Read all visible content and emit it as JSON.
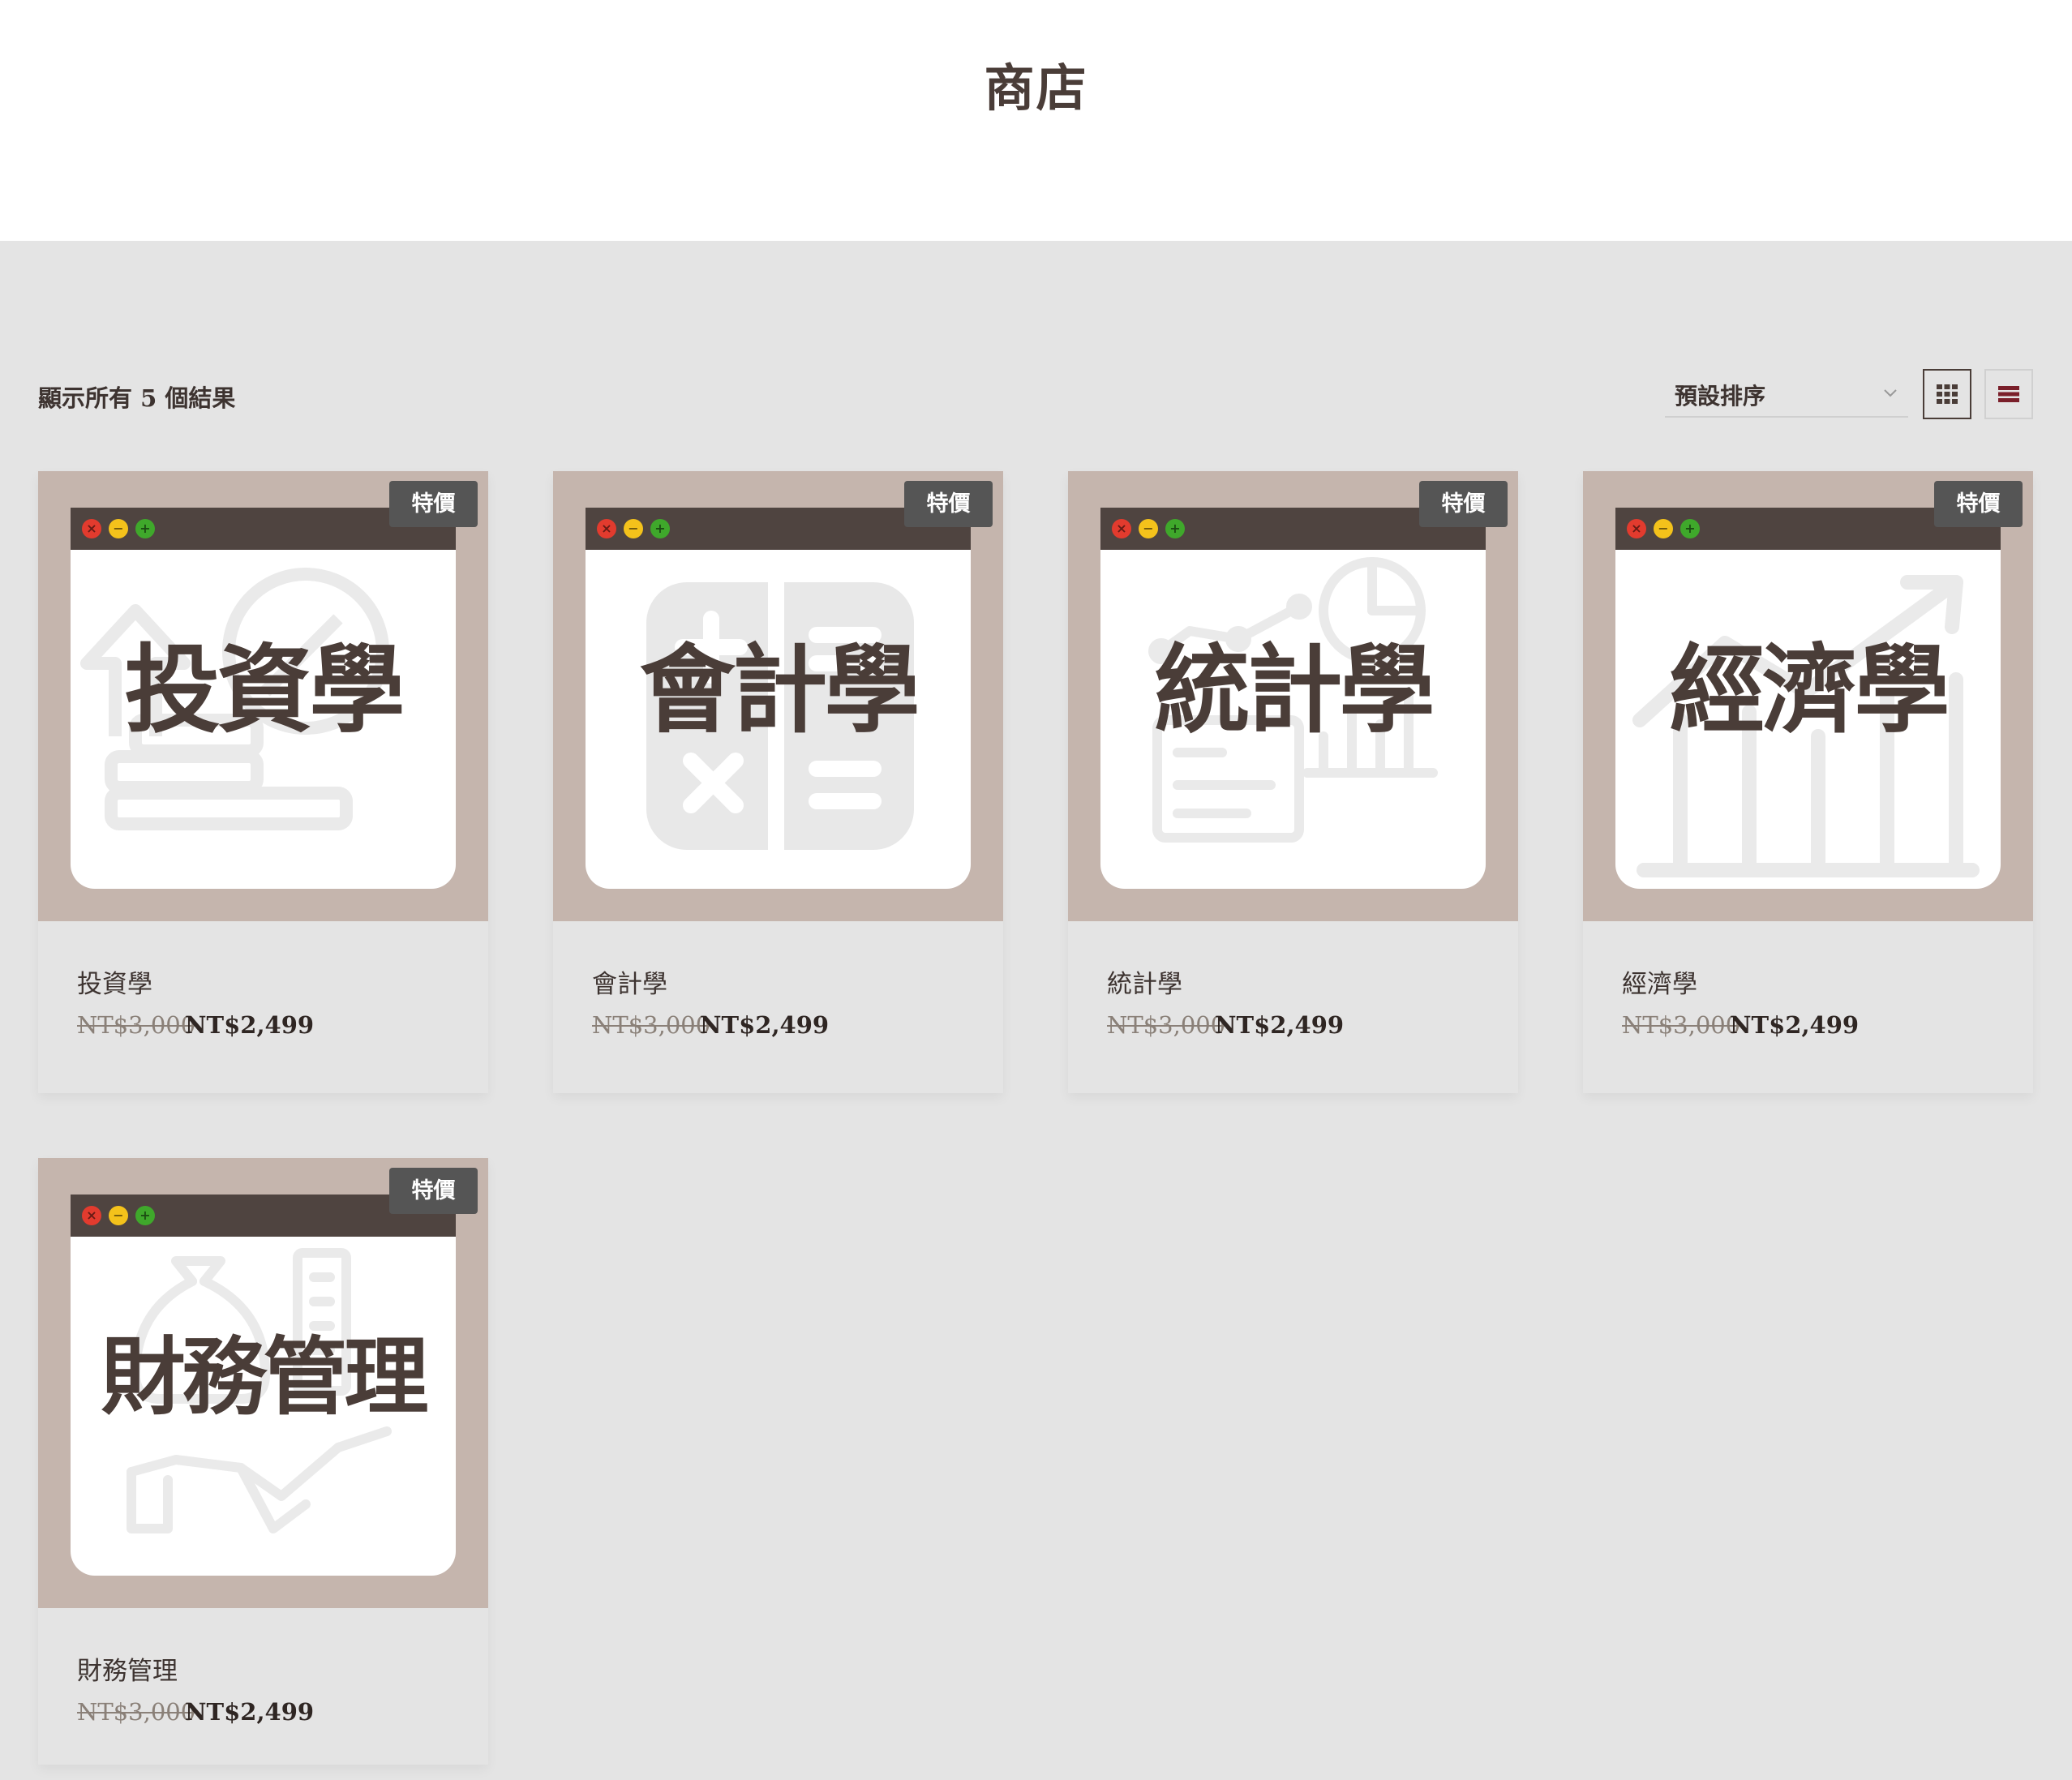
{
  "page": {
    "title": "商店"
  },
  "toolbar": {
    "result_count": "顯示所有 5 個結果",
    "sort_label": "預設排序"
  },
  "badges": {
    "sale": "特價"
  },
  "products": [
    {
      "name": "投資學",
      "cover_text": "投資學",
      "price_regular": "NT$3,000",
      "price_sale": "NT$2,499",
      "icon": "investment-icon"
    },
    {
      "name": "會計學",
      "cover_text": "會計學",
      "price_regular": "NT$3,000",
      "price_sale": "NT$2,499",
      "icon": "calculator-icon"
    },
    {
      "name": "統計學",
      "cover_text": "統計學",
      "price_regular": "NT$3,000",
      "price_sale": "NT$2,499",
      "icon": "statistics-chart-icon"
    },
    {
      "name": "經濟學",
      "cover_text": "經濟學",
      "price_regular": "NT$3,000",
      "price_sale": "NT$2,499",
      "icon": "economics-trend-icon"
    },
    {
      "name": "財務管理",
      "cover_text": "財務管理",
      "price_regular": "NT$3,000",
      "price_sale": "NT$2,499",
      "icon": "finance-money-icon"
    }
  ],
  "colors": {
    "accent": "#4a3d38",
    "thumb_bg": "#c5b5ad",
    "badge_bg": "#555555",
    "page_bg": "#e4e4e4"
  }
}
